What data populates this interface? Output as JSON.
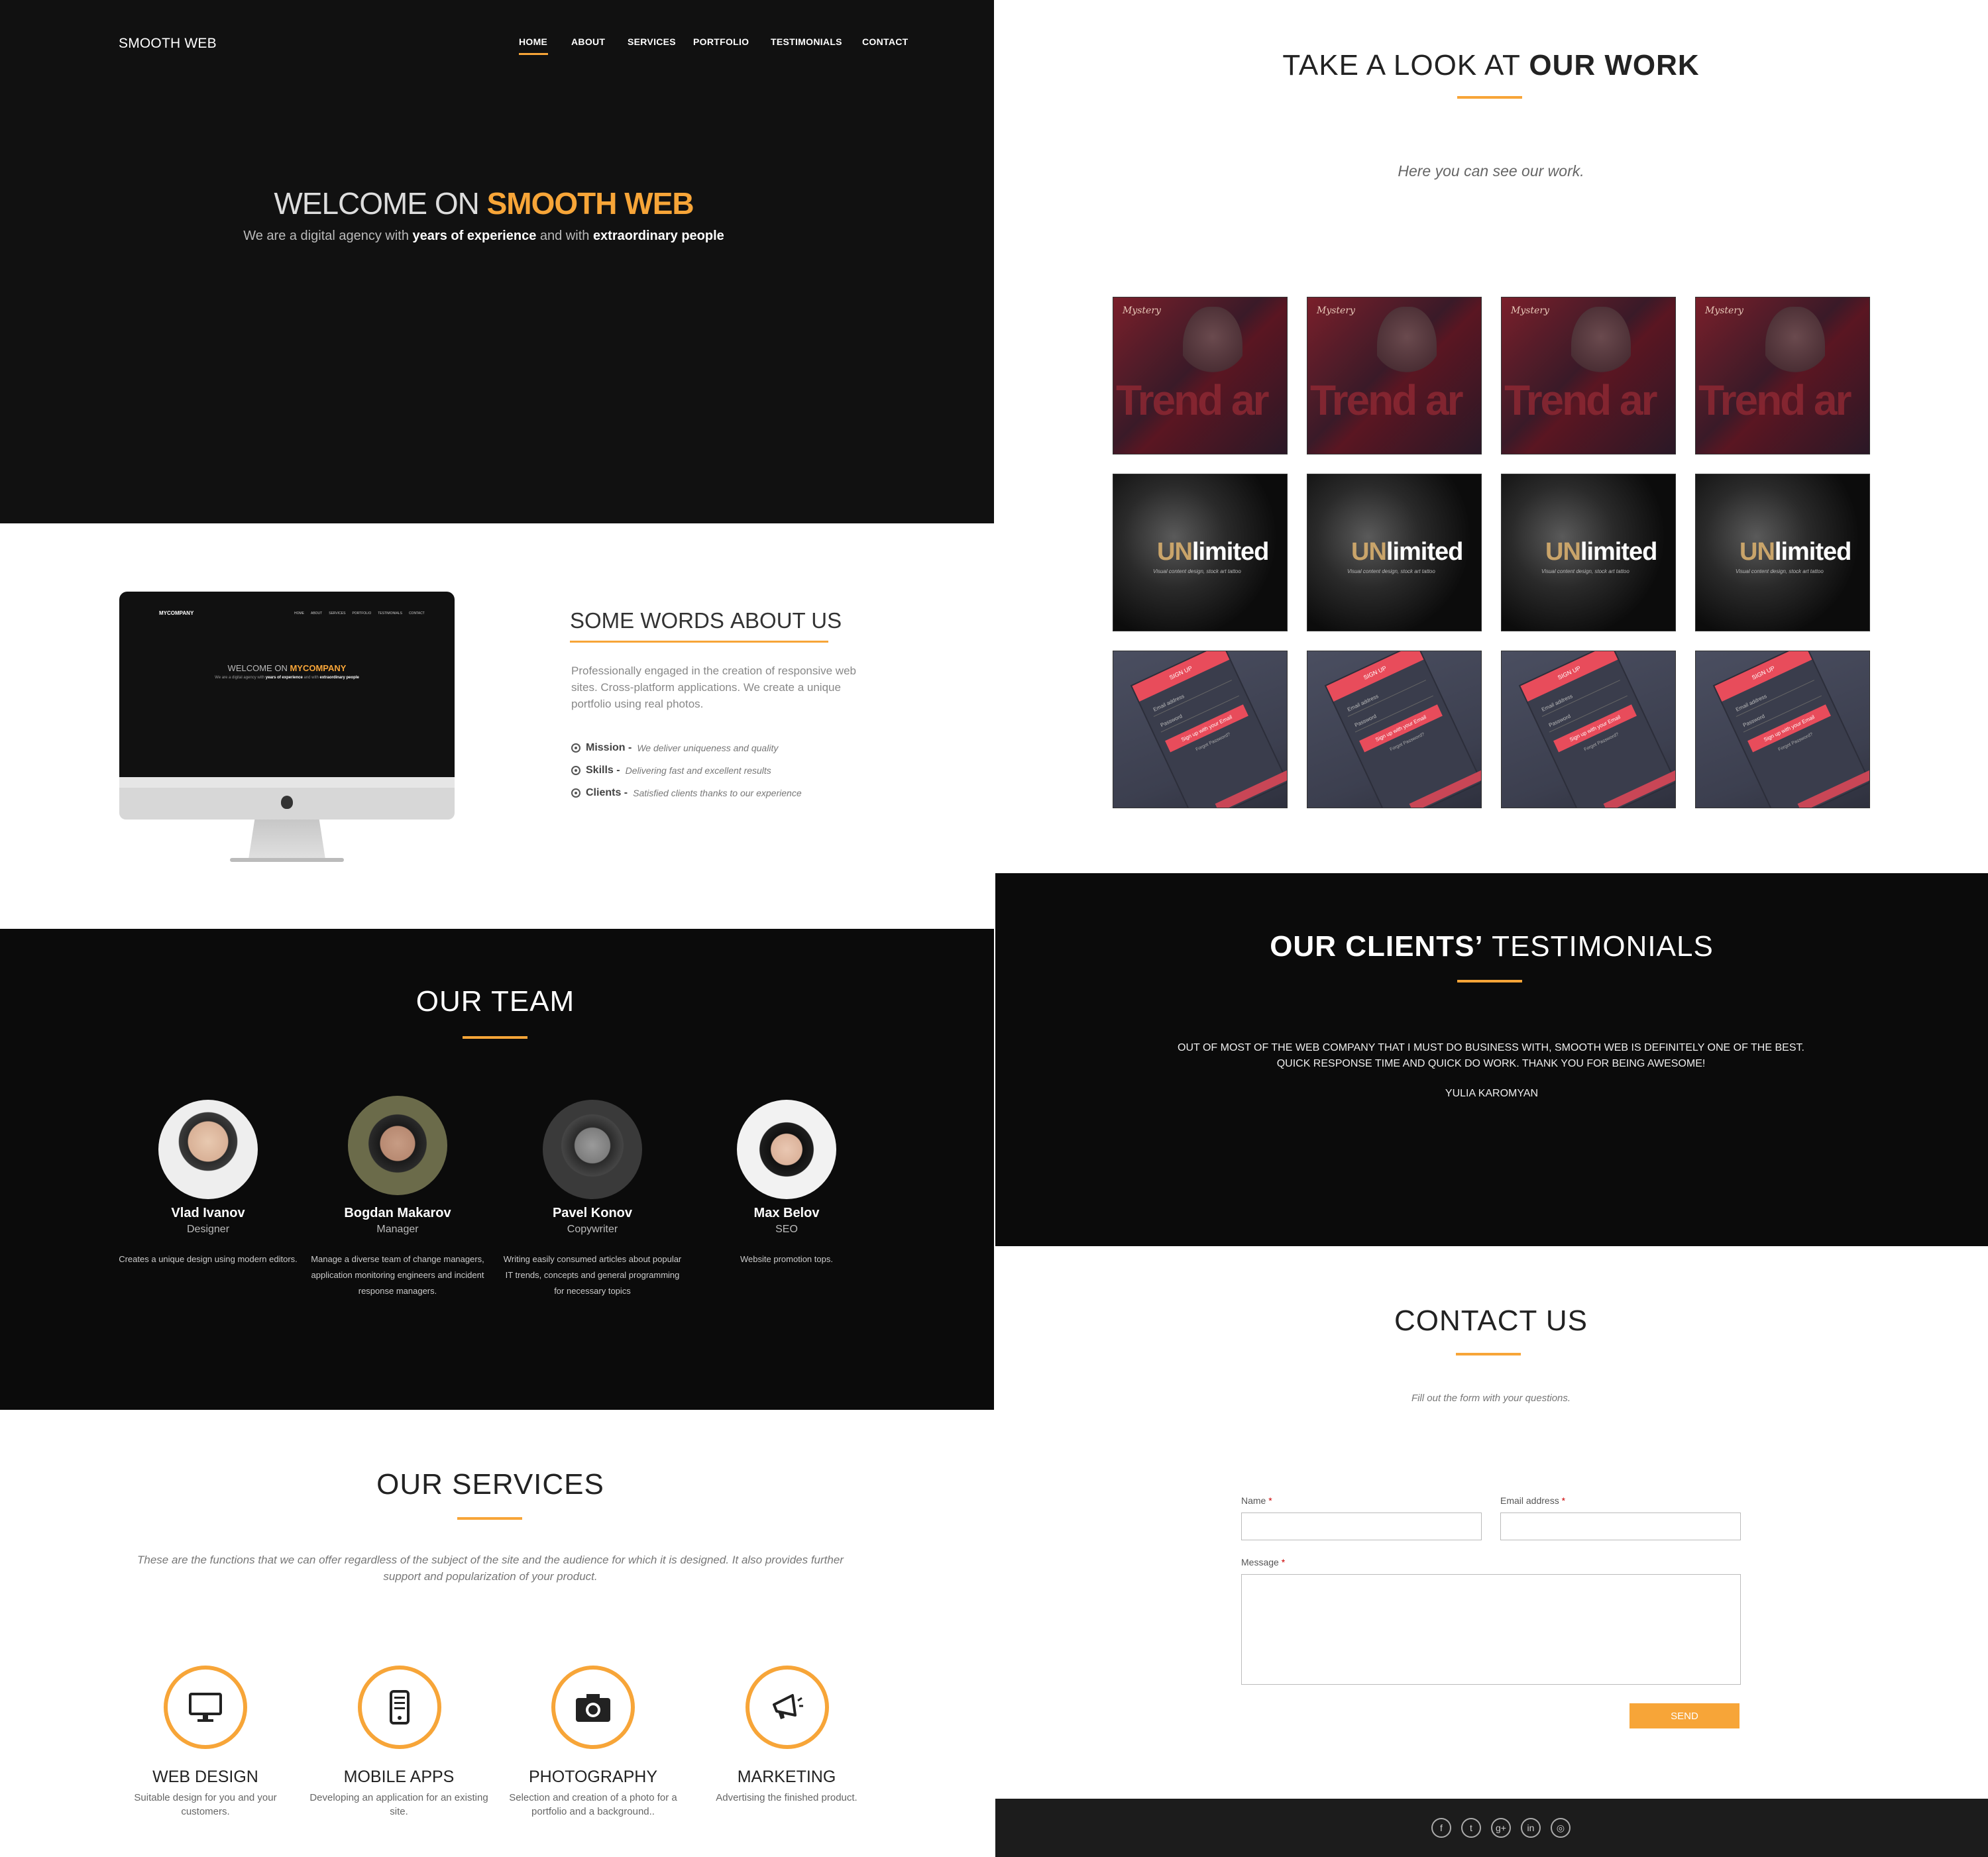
{
  "nav": {
    "logo": "SMOOTH WEB",
    "items": [
      "HOME",
      "ABOUT",
      "SERVICES",
      "PORTFOLIO",
      "TESTIMONIALS",
      "CONTACT"
    ]
  },
  "hero": {
    "title_light": "WELCOME ON ",
    "title_accent": "SMOOTH WEB",
    "sub_1": "We are a digital agency with ",
    "sub_b1": "years of experience",
    "sub_2": " and with ",
    "sub_b2": "extraordinary people"
  },
  "about": {
    "title_light": "SOME WORDS ",
    "title_bold": "ABOUT US",
    "text": "Professionally engaged in the creation of responsive web sites. Cross-platform applications. We create a unique portfolio using real photos.",
    "list": [
      {
        "label": "Mission -",
        "desc": "We deliver uniqueness and quality"
      },
      {
        "label": "Skills -",
        "desc": "Delivering fast and excellent results"
      },
      {
        "label": "Clients -",
        "desc": "Satisfied clients thanks to our experience"
      }
    ],
    "monitor": {
      "logo": "MYCOMPANY",
      "nav": [
        "HOME",
        "ABOUT",
        "SERVICES",
        "PORTFOLIO",
        "TESTIMONIALS",
        "CONTACT"
      ],
      "title_light": "WELCOME ON ",
      "title_accent": "MYCOMPANY",
      "sub_1": "We are a digital agency with ",
      "sub_b1": "years of experience",
      "sub_2": " and with ",
      "sub_b2": "extraordinary people"
    }
  },
  "team": {
    "title": "OUR TEAM",
    "members": [
      {
        "name": "Vlad Ivanov",
        "role": "Designer",
        "desc": "Creates a unique design using modern editors."
      },
      {
        "name": "Bogdan Makarov",
        "role": "Manager",
        "desc": "Manage a diverse team of change managers, application monitoring engineers and incident response managers."
      },
      {
        "name": "Pavel Konov",
        "role": "Copywriter",
        "desc": "Writing easily consumed articles about popular IT trends, concepts and general programming for necessary topics"
      },
      {
        "name": "Max Belov",
        "role": "SEO",
        "desc": "Website promotion tops."
      }
    ]
  },
  "services": {
    "title": "OUR SERVICES",
    "intro": "These are the functions that we can offer regardless of the subject of the site and the audience for which it is designed. It also provides further support and popularization of your product.",
    "items": [
      {
        "title": "WEB DESIGN",
        "desc": "Suitable design for you and your customers.",
        "icon": "monitor-icon"
      },
      {
        "title": "MOBILE APPS",
        "desc": "Developing an application for an existing site.",
        "icon": "smartphone-icon"
      },
      {
        "title": "PHOTOGRAPHY",
        "desc": "Selection and creation of a photo for a portfolio and a background..",
        "icon": "camera-icon"
      },
      {
        "title": "MARKETING",
        "desc": "Advertising the finished product.",
        "icon": "megaphone-icon"
      }
    ]
  },
  "work": {
    "title_light": "TAKE A LOOK AT ",
    "title_bold": "OUR WORK",
    "sub": "Here you can see our work.",
    "thumb_red": {
      "script": "Mystery",
      "word": "Trend ar"
    },
    "thumb_dark": {
      "word_1": "UN",
      "word_2": "limited",
      "tagline": "Visual content design, stock art tattoo"
    },
    "thumb_app": {
      "bar": "SIGN UP",
      "field_1": "Email address",
      "field_2": "Password",
      "button": "Sign up with your Email",
      "footer": "Forgot Password?"
    }
  },
  "testimonials": {
    "title_bold": "OUR CLIENTS’",
    "title_light": " TESTIMONIALS",
    "quote": "OUT OF MOST OF THE WEB COMPANY THAT I MUST DO BUSINESS WITH, SMOOTH WEB IS DEFINITELY ONE OF THE BEST. QUICK RESPONSE TIME AND QUICK DO WORK. THANK YOU FOR BEING AWESOME!",
    "author": "YULIA KAROMYAN"
  },
  "contact": {
    "title": "CONTACT US",
    "sub": "Fill out the form with your questions.",
    "name_label": "Name",
    "email_label": "Email address",
    "message_label": "Message",
    "required_mark": "*",
    "send": "SEND"
  },
  "footer": {
    "social": [
      "f",
      "t",
      "g+",
      "in",
      "◎"
    ]
  },
  "colors": {
    "accent": "#f7a538",
    "dark": "#111111"
  }
}
